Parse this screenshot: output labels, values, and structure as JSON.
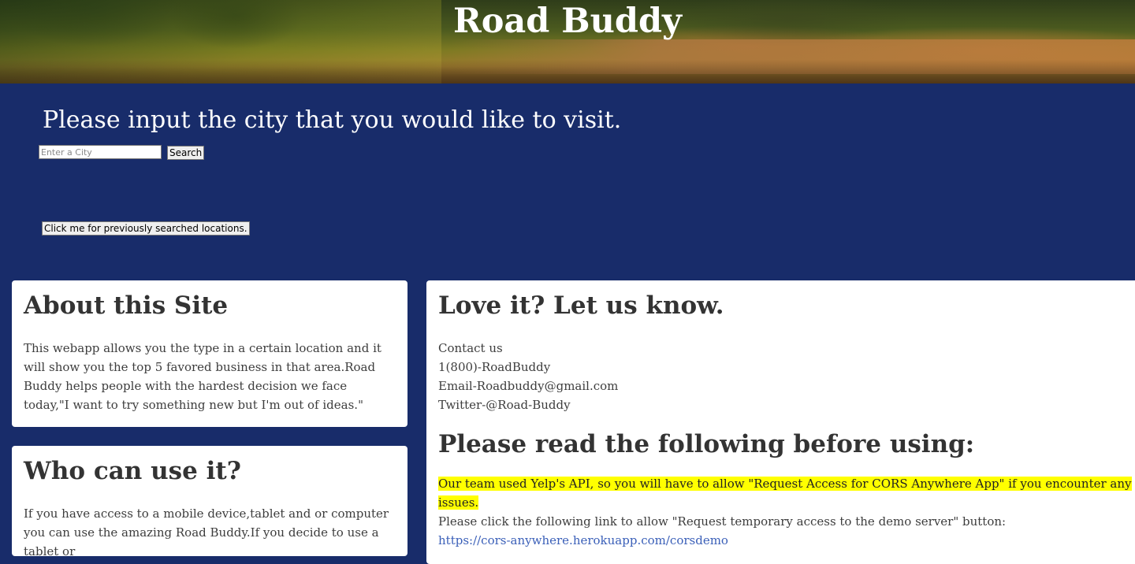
{
  "header": {
    "title": "Road Buddy"
  },
  "search": {
    "prompt": "Please input the city that you would like to visit.",
    "placeholder": "Enter a City",
    "button_label": "Search",
    "history_button_label": "Click me for previously searched locations."
  },
  "about": {
    "heading": "About this Site",
    "body": "This webapp allows you the type in a certain location and it will show you the top 5 favored business in that area.Road Buddy helps people with the hardest decision we face today,\"I want to try something new but I'm out of ideas.\""
  },
  "who": {
    "heading": "Who can use it?",
    "body": "If you have access to a mobile device,tablet and or computer you can use the amazing Road Buddy.If you decide to use a tablet or"
  },
  "contact": {
    "heading": "Love it? Let us know.",
    "lines": [
      "Contact us",
      "1(800)-RoadBuddy",
      "Email-Roadbuddy@gmail.com",
      "Twitter-@Road-Buddy"
    ],
    "notice_heading": "Please read the following before using:",
    "notice_highlight": "Our team used Yelp's API, so you will have to allow \"Request Access for CORS Anywhere App\" if you encounter any issues.",
    "notice_text": "Please click the following link to allow \"Request temporary access to the demo server\" button:",
    "notice_link": "https://cors-anywhere.herokuapp.com/corsdemo"
  },
  "colors": {
    "background": "#182c6a",
    "highlight": "#ffff00",
    "link": "#3a5fb8"
  }
}
